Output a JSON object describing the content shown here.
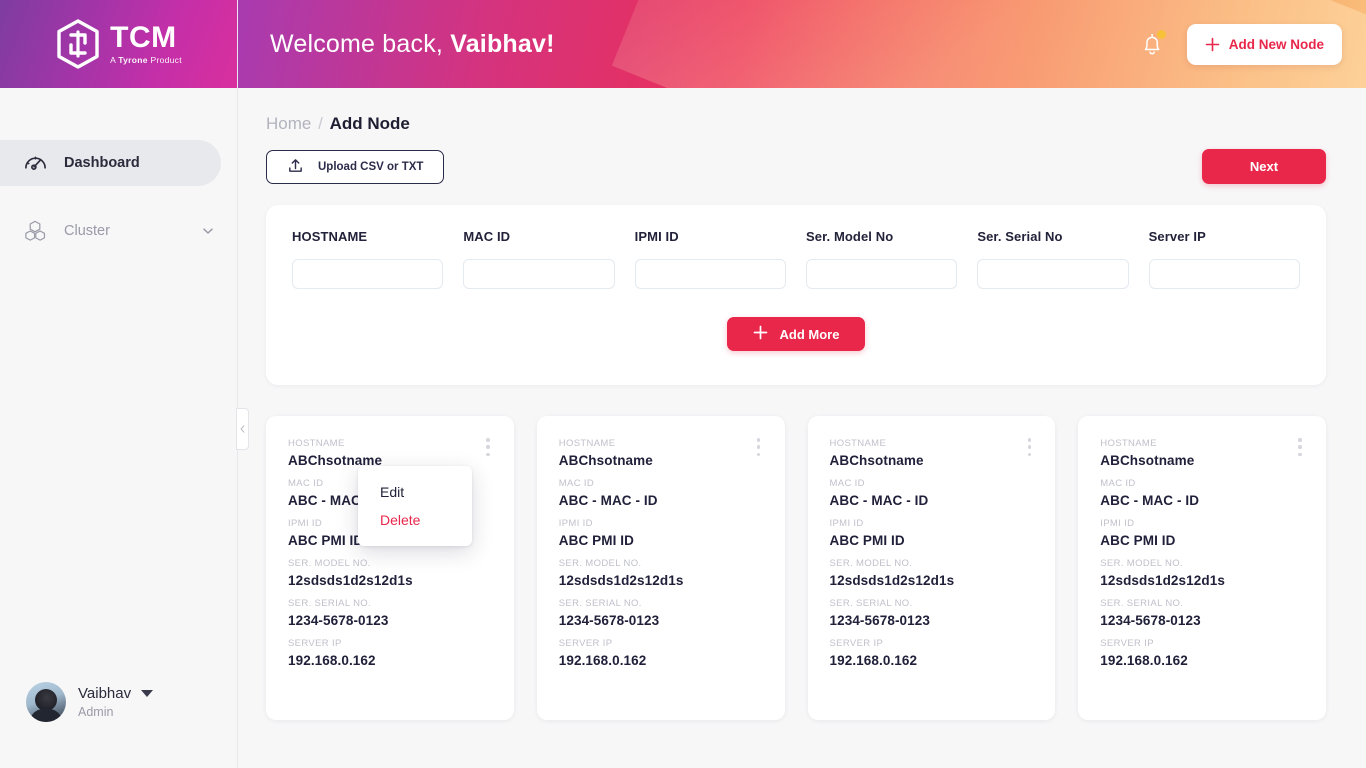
{
  "brand": {
    "title": "TCM",
    "subtitle_pre": "A ",
    "subtitle_bold": "Tyrone",
    "subtitle_post": " Product",
    "logo_icon": "hexagon-logo-icon"
  },
  "sidebar": {
    "items": [
      {
        "label": "Dashboard",
        "icon": "gauge-icon",
        "active": true,
        "has_chevron": false
      },
      {
        "label": "Cluster",
        "icon": "cubes-icon",
        "active": false,
        "has_chevron": true
      }
    ],
    "collapse_handle_icon": "chevron-left-icon",
    "profile": {
      "name": "Vaibhav",
      "role": "Admin",
      "avatar_icon": "avatar",
      "caret_icon": "caret-down-icon"
    }
  },
  "topbar": {
    "welcome_prefix": "Welcome back,",
    "welcome_name": "Vaibhav!",
    "bell_icon": "bell-icon",
    "bell_has_badge": true,
    "add_node_label": "Add New Node",
    "add_node_icon": "plus-icon"
  },
  "breadcrumb": {
    "home": "Home",
    "separator": "/",
    "current": "Add Node"
  },
  "toolbar": {
    "upload_label": "Upload CSV or TXT",
    "upload_icon": "upload-icon",
    "next_label": "Next"
  },
  "form": {
    "fields": [
      {
        "label": "HOSTNAME",
        "value": "",
        "placeholder": ""
      },
      {
        "label": "MAC ID",
        "value": "",
        "placeholder": ""
      },
      {
        "label": "IPMI ID",
        "value": "",
        "placeholder": ""
      },
      {
        "label": "Ser. Model No",
        "value": "",
        "placeholder": ""
      },
      {
        "label": "Ser. Serial No",
        "value": "",
        "placeholder": ""
      },
      {
        "label": "Server IP",
        "value": "",
        "placeholder": ""
      }
    ],
    "add_more_label": "Add More",
    "add_more_icon": "plus-icon"
  },
  "context_menu": {
    "visible": true,
    "items": [
      {
        "label": "Edit",
        "danger": false
      },
      {
        "label": "Delete",
        "danger": true
      }
    ]
  },
  "cards": [
    {
      "fields": [
        {
          "key": "HOSTNAME",
          "value": "ABChsotname"
        },
        {
          "key": "MAC ID",
          "value": "ABC - MAC - ID"
        },
        {
          "key": "IPMI ID",
          "value": "ABC PMI ID"
        },
        {
          "key": "SER. MODEL NO.",
          "value": "12sdsds1d2s12d1s"
        },
        {
          "key": "SER. SERIAL NO.",
          "value": "1234-5678-0123"
        },
        {
          "key": "SERVER IP",
          "value": "192.168.0.162"
        }
      ],
      "menu_icon": "kebab-menu-icon"
    },
    {
      "fields": [
        {
          "key": "HOSTNAME",
          "value": "ABChsotname"
        },
        {
          "key": "MAC ID",
          "value": "ABC - MAC - ID"
        },
        {
          "key": "IPMI ID",
          "value": "ABC PMI ID"
        },
        {
          "key": "SER. MODEL NO.",
          "value": "12sdsds1d2s12d1s"
        },
        {
          "key": "SER. SERIAL NO.",
          "value": "1234-5678-0123"
        },
        {
          "key": "SERVER IP",
          "value": "192.168.0.162"
        }
      ],
      "menu_icon": "kebab-menu-icon"
    },
    {
      "fields": [
        {
          "key": "HOSTNAME",
          "value": "ABChsotname"
        },
        {
          "key": "MAC ID",
          "value": "ABC - MAC - ID"
        },
        {
          "key": "IPMI ID",
          "value": "ABC PMI ID"
        },
        {
          "key": "SER. MODEL NO.",
          "value": "12sdsds1d2s12d1s"
        },
        {
          "key": "SER. SERIAL NO.",
          "value": "1234-5678-0123"
        },
        {
          "key": "SERVER IP",
          "value": "192.168.0.162"
        }
      ],
      "menu_icon": "kebab-menu-icon"
    },
    {
      "fields": [
        {
          "key": "HOSTNAME",
          "value": "ABChsotname"
        },
        {
          "key": "MAC ID",
          "value": "ABC - MAC - ID"
        },
        {
          "key": "IPMI ID",
          "value": "ABC PMI ID"
        },
        {
          "key": "SER. MODEL NO.",
          "value": "12sdsds1d2s12d1s"
        },
        {
          "key": "SER. SERIAL NO.",
          "value": "1234-5678-0123"
        },
        {
          "key": "SERVER IP",
          "value": "192.168.0.162"
        }
      ],
      "menu_icon": "kebab-menu-icon"
    }
  ],
  "colors": {
    "accent_red": "#e8274a",
    "badge_yellow": "#f7c23a",
    "text_dark": "#20203a",
    "text_muted": "#9a9aa8",
    "page_bg": "#f7f7f8"
  }
}
